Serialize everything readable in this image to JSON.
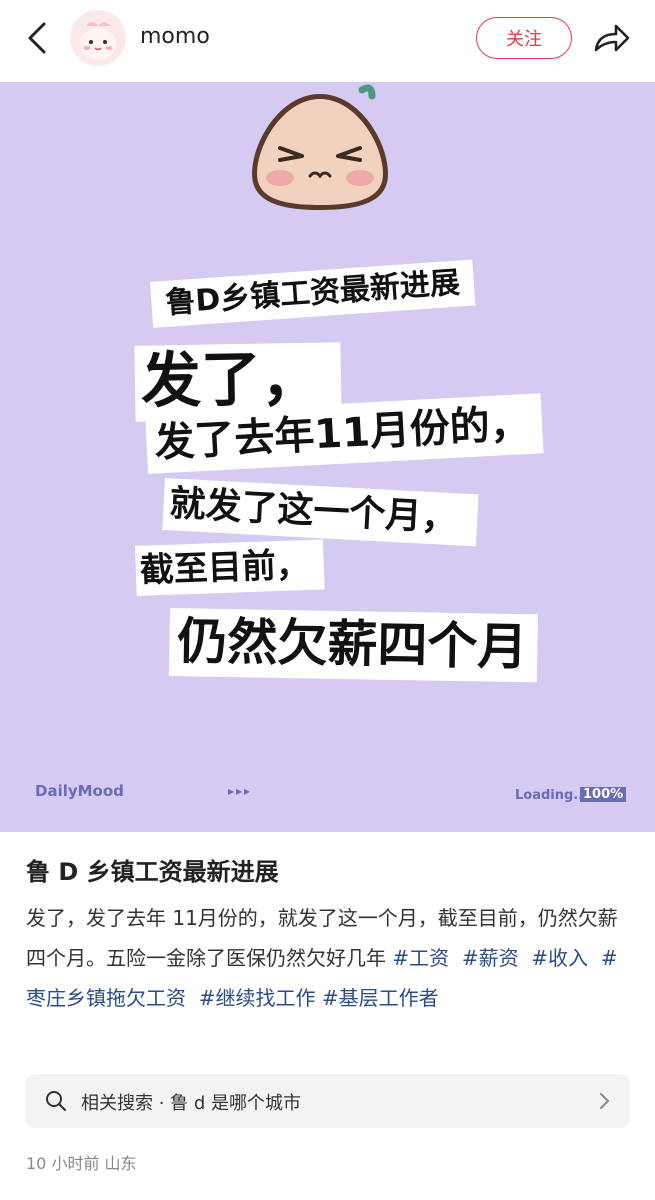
{
  "header": {
    "username": "momo",
    "follow_label": "关注"
  },
  "poster": {
    "lines": [
      "鲁D乡镇工资最新进展",
      "发了，",
      "发了去年11月份的，",
      "就发了这一个月，",
      "截至目前，",
      "仍然欠薪四个月"
    ],
    "brand": "DailyMood",
    "dots": "▸▸▸",
    "loading": "Loading...",
    "progress": "100%",
    "background": "#d4caf2"
  },
  "post": {
    "title": "鲁 D 乡镇工资最新进展",
    "body": "发了，发了去年 11月份的，就发了这一个月，截至目前，仍然欠薪四个月。五险一金除了医保仍然欠好几年",
    "tags": [
      "#工资",
      "#薪资",
      "#收入",
      "#枣庄乡镇拖欠工资",
      "#继续找工作",
      "#基层工作者"
    ]
  },
  "related_search": {
    "text": "相关搜索 · 鲁 d 是哪个城市"
  },
  "meta": {
    "time": "10 小时前",
    "location": "山东"
  },
  "colors": {
    "accent": "#e23a4e",
    "tag": "#2a4d8a"
  },
  "icons": [
    "back-arrow-icon",
    "avatar",
    "share-icon",
    "search-icon",
    "chevron-right-icon"
  ]
}
